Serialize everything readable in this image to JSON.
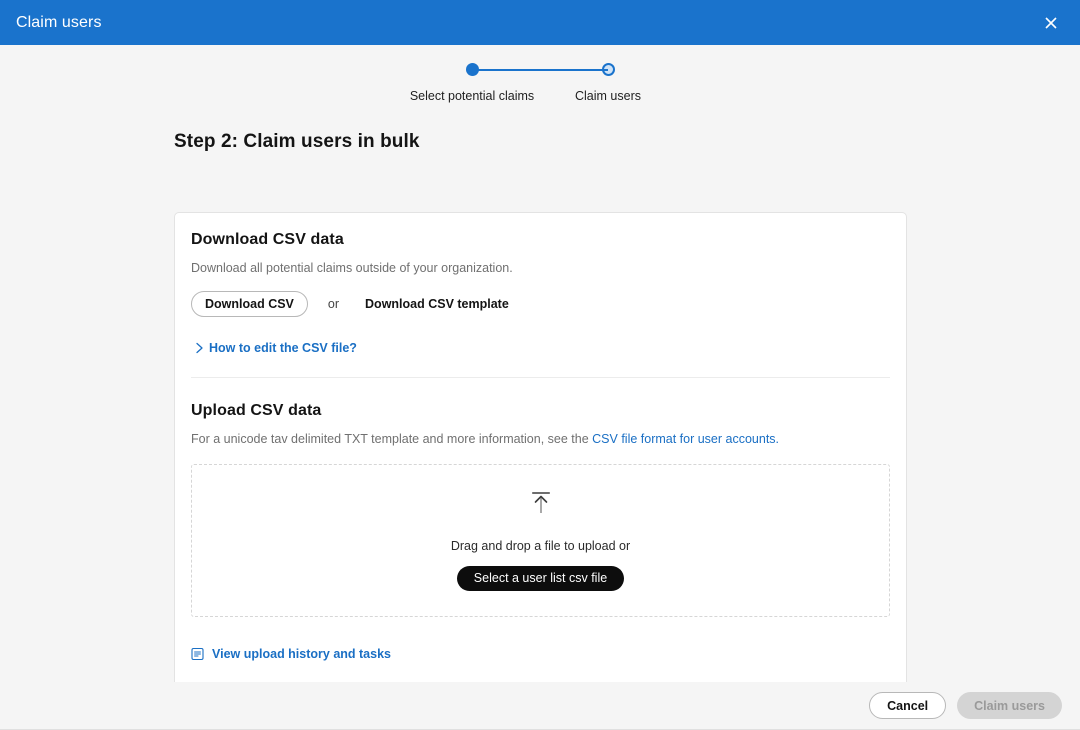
{
  "header": {
    "title": "Claim users",
    "close_icon": "close-icon"
  },
  "stepper": {
    "steps": [
      {
        "label": "Select potential claims",
        "state": "done"
      },
      {
        "label": "Claim users",
        "state": "current"
      }
    ],
    "accent_color": "#1a73cc"
  },
  "page": {
    "heading": "Step 2: Claim users in bulk"
  },
  "download_section": {
    "title": "Download CSV data",
    "description": "Download all potential claims outside of your organization.",
    "download_csv_label": "Download CSV",
    "or_label": "or",
    "download_template_label": "Download CSV template",
    "expand_link_label": "How to edit the CSV file?",
    "chevron_icon": "chevron-right-icon"
  },
  "upload_section": {
    "title": "Upload CSV data",
    "description_prefix": "For a unicode tav delimited TXT template and more information, see the ",
    "description_link": "CSV file format for user accounts.",
    "dropzone": {
      "upload_icon": "upload-arrow-icon",
      "drag_text": "Drag and drop a file to upload or",
      "select_file_label": "Select a user list csv file"
    },
    "history_link_label": "View upload history and tasks",
    "history_icon": "document-list-icon"
  },
  "footer": {
    "cancel_label": "Cancel",
    "primary_label": "Claim users",
    "primary_disabled": true
  },
  "colors": {
    "header_blue": "#1a73cc",
    "link_blue": "#1a6fc4",
    "dark_button": "#0d0d0d",
    "disabled_button": "#d4d4d4",
    "page_background": "#f5f5f5"
  }
}
